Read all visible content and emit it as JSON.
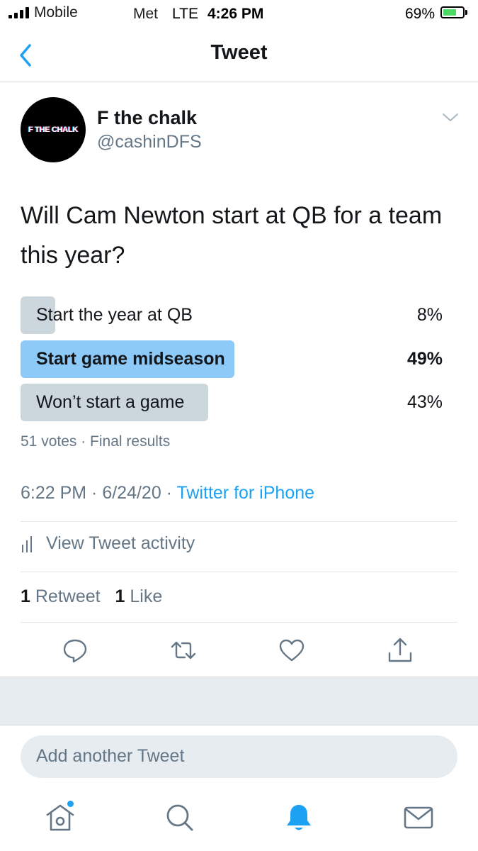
{
  "status_bar": {
    "carrier": "Mobile",
    "carrier2": "Met",
    "network": "LTE",
    "time": "4:26 PM",
    "battery": "69%",
    "battery_level": 0.69
  },
  "nav": {
    "title": "Tweet",
    "back_icon": "chevron-left-icon"
  },
  "author": {
    "name": "F the chalk",
    "handle": "@cashinDFS",
    "avatar_text": "F THE CHALK"
  },
  "tweet": {
    "text": "Will Cam Newton start at QB for a team this year?"
  },
  "poll": {
    "options": [
      {
        "label": "Start the year at QB",
        "percent": "8%",
        "fraction": 0.08,
        "winner": false
      },
      {
        "label": "Start game midseason",
        "percent": "49%",
        "fraction": 0.49,
        "winner": true
      },
      {
        "label": "Won’t start a game",
        "percent": "43%",
        "fraction": 0.43,
        "winner": false
      }
    ],
    "meta": "51 votes · Final results"
  },
  "timestamp": {
    "datetime": "6:22 PM · 6/24/20 · ",
    "source": "Twitter for iPhone"
  },
  "activity": {
    "label": "View Tweet activity",
    "icon": "analytics-icon"
  },
  "stats": {
    "retweets_count": "1",
    "retweets_label": "Retweet",
    "likes_count": "1",
    "likes_label": "Like"
  },
  "actions": [
    "reply-icon",
    "retweet-icon",
    "like-icon",
    "share-icon"
  ],
  "reply": {
    "placeholder": "Add another Tweet"
  },
  "tabs": [
    "home-icon",
    "search-icon",
    "notifications-icon",
    "messages-icon"
  ],
  "colors": {
    "accent": "#1da1f2",
    "winner_bar": "#8ecaf8",
    "bar": "#ccd6dd",
    "secondary_text": "#657786"
  }
}
